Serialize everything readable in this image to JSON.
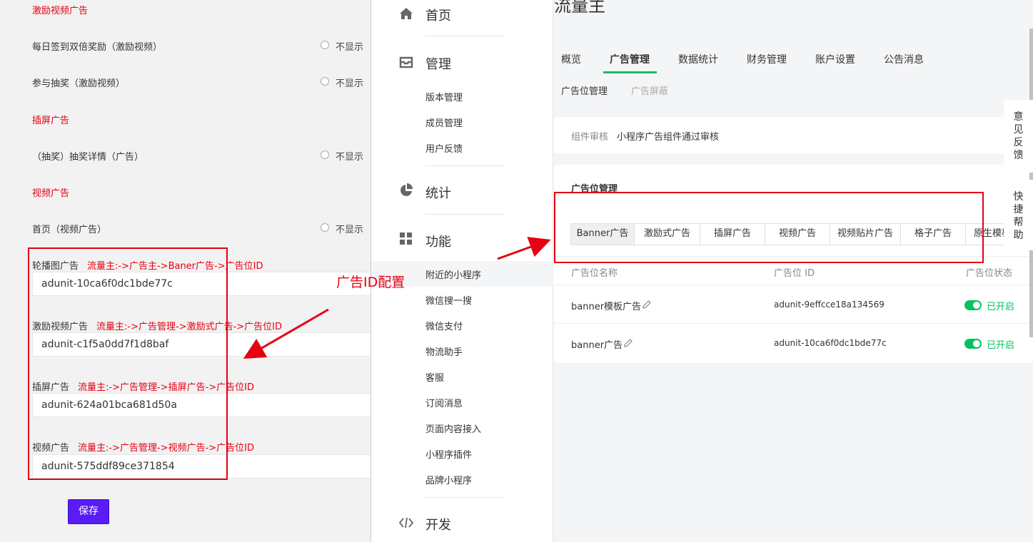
{
  "left": {
    "section_reward": "激励视频广告",
    "row_signin": "每日签到双倍奖励（激励视频）",
    "row_lottery": "参与抽奖（激励视频）",
    "section_interstitial": "插屏广告",
    "row_lottery_detail": "（抽奖）抽奖详情（广告）",
    "section_video": "视频广告",
    "row_home_video": "首页（视频广告）",
    "radio_label": "不显示",
    "fields": [
      {
        "label": "轮播图广告",
        "hint": "流量主:->广告主->Baner广告->广告位ID",
        "value": "adunit-10ca6f0dc1bde77c"
      },
      {
        "label": "激励视频广告",
        "hint": "流量主:->广告管理->激励式广告->广告位ID",
        "value": "adunit-c1f5a0dd7f1d8baf"
      },
      {
        "label": "插屏广告",
        "hint": "流量主:->广告管理->插屏广告->广告位ID",
        "value": "adunit-624a01bca681d50a"
      },
      {
        "label": "视频广告",
        "hint": "流量主:->广告管理->视频广告->广告位ID",
        "value": "adunit-575ddf89ce371854"
      }
    ],
    "save_label": "保存"
  },
  "annotation": {
    "text": "广告ID配置",
    "color": "#e60012"
  },
  "nav": {
    "home": "首页",
    "manage": "管理",
    "manage_items": [
      "版本管理",
      "成员管理",
      "用户反馈"
    ],
    "stats": "统计",
    "features": "功能",
    "feature_items": [
      "附近的小程序",
      "微信搜一搜",
      "微信支付",
      "物流助手",
      "客服",
      "订阅消息",
      "页面内容接入",
      "小程序插件",
      "品牌小程序"
    ],
    "dev": "开发"
  },
  "main": {
    "page_title": "流量主",
    "tabs": [
      "概览",
      "广告管理",
      "数据统计",
      "财务管理",
      "账户设置",
      "公告消息"
    ],
    "active_tab": "广告管理",
    "subnav": [
      "广告位管理",
      "广告屏蔽"
    ],
    "review_label": "组件审核",
    "review_value": "小程序广告组件通过审核",
    "section_title": "广告位管理",
    "ad_types": [
      "Banner广告",
      "激励式广告",
      "插屏广告",
      "视频广告",
      "视频贴片广告",
      "格子广告",
      "原生模板"
    ],
    "table_headers": [
      "广告位名称",
      "广告位 ID",
      "广告位状态"
    ],
    "rows": [
      {
        "name": "banner模板广告",
        "id": "adunit-9effcce18a134569",
        "status": "已开启"
      },
      {
        "name": "banner广告",
        "id": "adunit-10ca6f0dc1bde77c",
        "status": "已开启"
      }
    ],
    "side_feedback": "意见反馈",
    "side_help": "快捷帮助"
  },
  "colors": {
    "accent_green": "#07c160",
    "annotation_red": "#e60012",
    "save_purple": "#5a1cf5"
  }
}
